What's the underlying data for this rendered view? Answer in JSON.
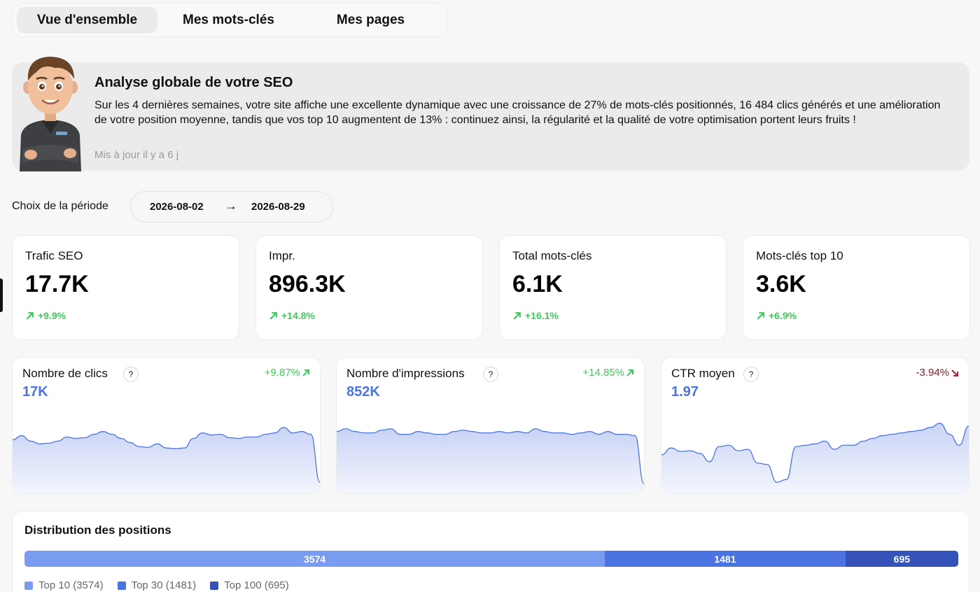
{
  "tabs": [
    {
      "label": "Vue d'ensemble",
      "active": true
    },
    {
      "label": "Mes mots-clés",
      "active": false
    },
    {
      "label": "Mes pages",
      "active": false
    }
  ],
  "hero": {
    "avatar_icon": "cartoon-avatar",
    "title": "Analyse globale de votre SEO",
    "text": "Sur les 4 dernières semaines, votre site affiche une excellente dynamique avec une croissance de 27% de mots-clés positionnés, 16 484 clics générés et une amélioration de votre position moyenne, tandis que vos top 10 augmentent de 13% : continuez ainsi, la régularité et la qualité de votre optimisation portent leurs fruits !",
    "updated": "Mis à jour il y a 6 j"
  },
  "period": {
    "label": "Choix de la période",
    "start": "2026-08-02",
    "arrow": "→",
    "end": "2026-08-29"
  },
  "kpis": [
    {
      "label": "Trafic SEO",
      "value": "17.7K",
      "delta": "+9.9%"
    },
    {
      "label": "Impr.",
      "value": "896.3K",
      "delta": "+14.8%"
    },
    {
      "label": "Total mots-clés",
      "value": "6.1K",
      "delta": "+16.1%"
    },
    {
      "label": "Mots-clés top 10",
      "value": "3.6K",
      "delta": "+6.9%"
    }
  ],
  "sparklines": [
    {
      "title": "Nombre de clics",
      "help": "?",
      "value": "17K",
      "delta": "+9.87%",
      "trend": "up",
      "color": "#3ec95b",
      "series": [
        0.72,
        0.78,
        0.7,
        0.66,
        0.67,
        0.7,
        0.76,
        0.74,
        0.75,
        0.8,
        0.84,
        0.8,
        0.74,
        0.68,
        0.62,
        0.61,
        0.66,
        0.6,
        0.59,
        0.6,
        0.74,
        0.82,
        0.79,
        0.8,
        0.75,
        0.74,
        0.76,
        0.76,
        0.8,
        0.82,
        0.9,
        0.82,
        0.84,
        0.8,
        0.1
      ]
    },
    {
      "title": "Nombre d'impressions",
      "help": "?",
      "value": "852K",
      "delta": "+14.85%",
      "trend": "up",
      "color": "#3ec95b",
      "series": [
        0.84,
        0.88,
        0.84,
        0.82,
        0.82,
        0.86,
        0.88,
        0.8,
        0.8,
        0.84,
        0.82,
        0.8,
        0.8,
        0.84,
        0.86,
        0.84,
        0.82,
        0.82,
        0.84,
        0.82,
        0.84,
        0.82,
        0.88,
        0.84,
        0.82,
        0.82,
        0.8,
        0.82,
        0.84,
        0.8,
        0.84,
        0.8,
        0.8,
        0.78,
        0.08
      ]
    },
    {
      "title": "CTR moyen",
      "help": "?",
      "value": "1.97",
      "delta": "-3.94%",
      "trend": "down",
      "color": "#7a1a2a",
      "series": [
        0.5,
        0.6,
        0.55,
        0.56,
        0.52,
        0.4,
        0.62,
        0.64,
        0.56,
        0.58,
        0.38,
        0.36,
        0.1,
        0.14,
        0.62,
        0.64,
        0.66,
        0.7,
        0.58,
        0.64,
        0.64,
        0.7,
        0.74,
        0.78,
        0.8,
        0.82,
        0.84,
        0.86,
        0.9,
        0.96,
        0.8,
        0.64,
        0.92
      ]
    }
  ],
  "distribution": {
    "title": "Distribution des positions",
    "segments": [
      {
        "value": 3574,
        "label": "3574",
        "color": "#7a9cf0"
      },
      {
        "value": 1481,
        "label": "1481",
        "color": "#4b74e0"
      },
      {
        "value": 695,
        "label": "695",
        "color": "#3552b8"
      }
    ],
    "legend": [
      {
        "label": "Top 10 (3574)",
        "color": "#7a9cf0"
      },
      {
        "label": "Top 30 (1481)",
        "color": "#4b74e0"
      },
      {
        "label": "Top 100 (695)",
        "color": "#3552b8"
      }
    ]
  },
  "colors": {
    "accent": "#4b74e0",
    "positive": "#3ec95b",
    "negative": "#7a1a2a"
  }
}
